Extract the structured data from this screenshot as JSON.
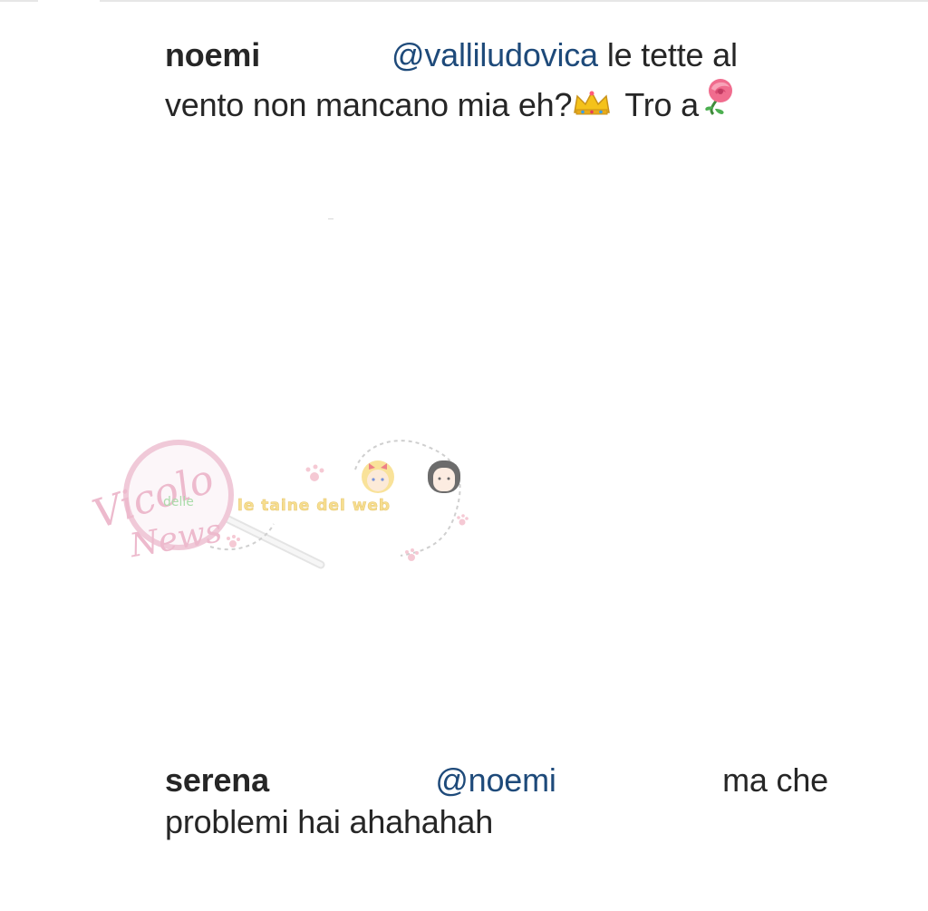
{
  "comments": [
    {
      "username": "noemi",
      "mention": "@valliludovica",
      "line1_rest": "le tette al",
      "line2_text": "vento non mancano mia eh?",
      "emoji_after_question": "crown-emoji",
      "line2_tail": "Tro a",
      "emoji_end": "rose-emoji"
    },
    {
      "username": "serena",
      "mention": "@noemi",
      "line1_rest": "ma che",
      "line2_text": "problemi hai ahahahah"
    }
  ],
  "watermark": {
    "logo_text_main": "Vicolo",
    "logo_text_small": "delle",
    "logo_text_bottom": "News",
    "tagline": "le taine del web"
  },
  "colors": {
    "text": "#262626",
    "mention": "#1e4a7a",
    "watermark_pink": "#e7a3bd",
    "watermark_yellow": "#f5d36a"
  }
}
